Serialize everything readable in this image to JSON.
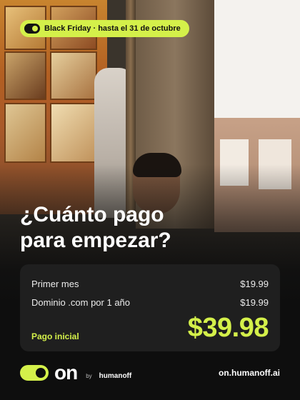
{
  "promo": {
    "label": "Black Friday · hasta el 31 de octubre"
  },
  "headline": {
    "line1": "¿Cuánto pago",
    "line2": "para empezar?"
  },
  "pricing": {
    "rows": [
      {
        "label": "Primer mes",
        "value": "$19.99"
      },
      {
        "label": "Dominio .com por 1 año",
        "value": "$19.99"
      }
    ],
    "total_label": "Pago inicial",
    "total_value": "$39.98"
  },
  "brand": {
    "word": "on",
    "by": "by",
    "company": "humanoff"
  },
  "website": "on.humanoff.ai",
  "colors": {
    "accent": "#d4f04a",
    "background": "#0e0e0e",
    "card": "#1f1f1f"
  }
}
